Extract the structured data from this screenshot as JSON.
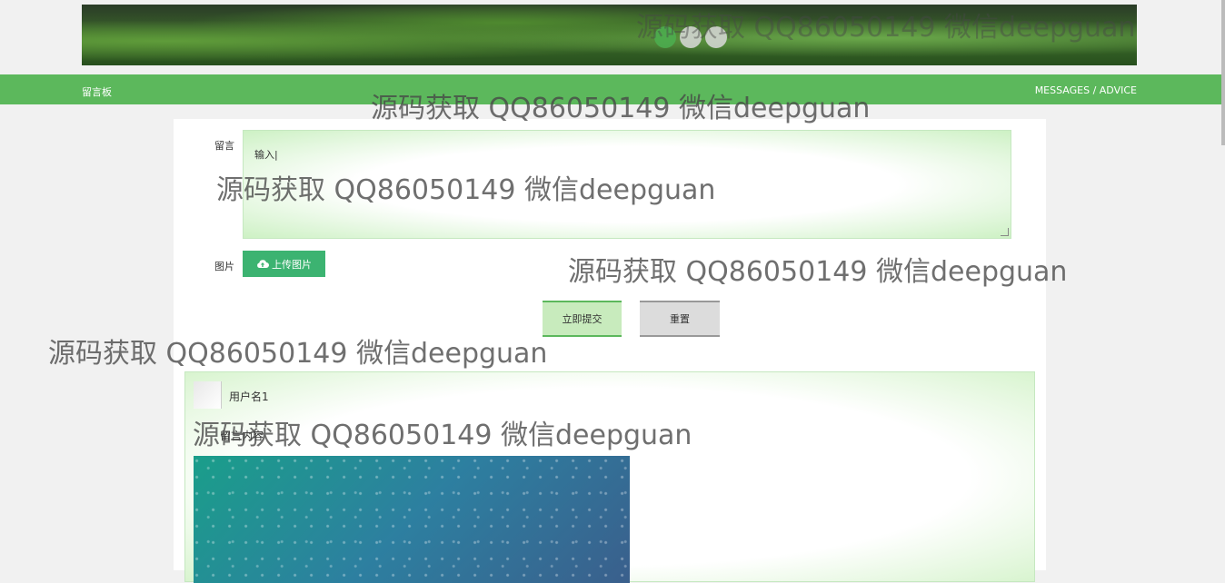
{
  "nav": {
    "left_title": "留言板",
    "right_title": "MESSAGES / ADVICE"
  },
  "carousel": {
    "dot_count": 3,
    "active_index": 0
  },
  "form": {
    "message_label": "留言",
    "message_value": "输入|",
    "image_label": "图片",
    "upload_button": "上传图片",
    "submit_button": "立即提交",
    "reset_button": "重置"
  },
  "message": {
    "username": "用户名1",
    "content": "留言内容"
  },
  "watermark": "源码获取 QQ86050149 微信deepguan",
  "colors": {
    "nav_green": "#5cb85c",
    "upload_green": "#3cb371",
    "submit_bg": "#c8ebbd",
    "reset_bg": "#dcdcdc"
  }
}
